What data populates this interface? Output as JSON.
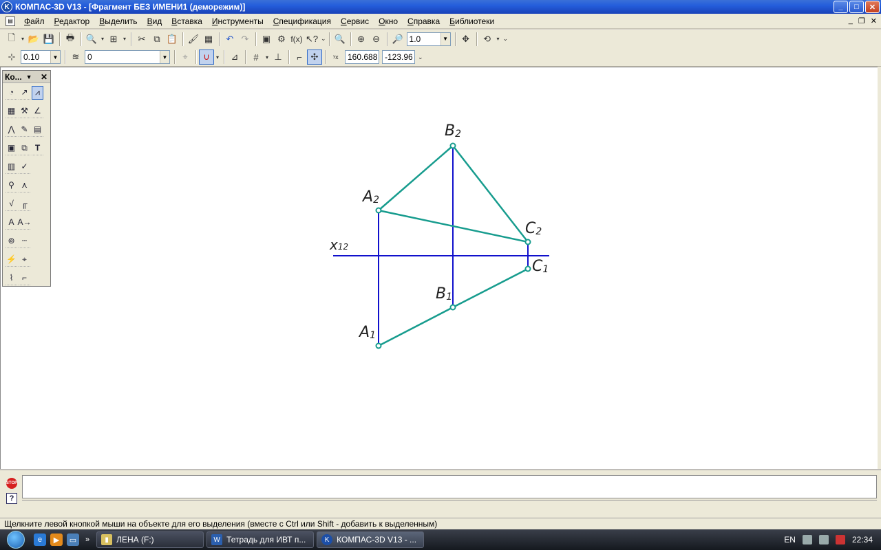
{
  "window": {
    "title": "КОМПАС-3D V13 - [Фрагмент БЕЗ ИМЕНИ1 (деморежим)]"
  },
  "menu": [
    "Файл",
    "Редактор",
    "Выделить",
    "Вид",
    "Вставка",
    "Инструменты",
    "Спецификация",
    "Сервис",
    "Окно",
    "Справка",
    "Библиотеки"
  ],
  "toolbar": {
    "zoom_value": "1.0"
  },
  "props": {
    "step": "0.10",
    "layer": "0",
    "coord_x": "160.688",
    "coord_y": "-123.96"
  },
  "panel": {
    "title": "Ко..."
  },
  "drawing": {
    "colors": {
      "projection_lines": "#1010cc",
      "figure_lines": "#179c8e",
      "labels": "#222222"
    },
    "axis_label": "x",
    "axis_sub": "12",
    "points": [
      {
        "name": "A",
        "sub": "2"
      },
      {
        "name": "B",
        "sub": "2"
      },
      {
        "name": "C",
        "sub": "2"
      },
      {
        "name": "A",
        "sub": "1"
      },
      {
        "name": "B",
        "sub": "1"
      },
      {
        "name": "C",
        "sub": "1"
      }
    ]
  },
  "status": {
    "hint": "Щелкните левой кнопкой мыши на объекте для его выделения (вместе с Ctrl или Shift - добавить к выделенным)"
  },
  "taskbar": {
    "tasks": [
      "ЛЕНА (F:)",
      "Тетрадь для ИВТ п...",
      "КОМПАС-3D V13 - ..."
    ],
    "lang": "EN",
    "time": "22:34"
  }
}
